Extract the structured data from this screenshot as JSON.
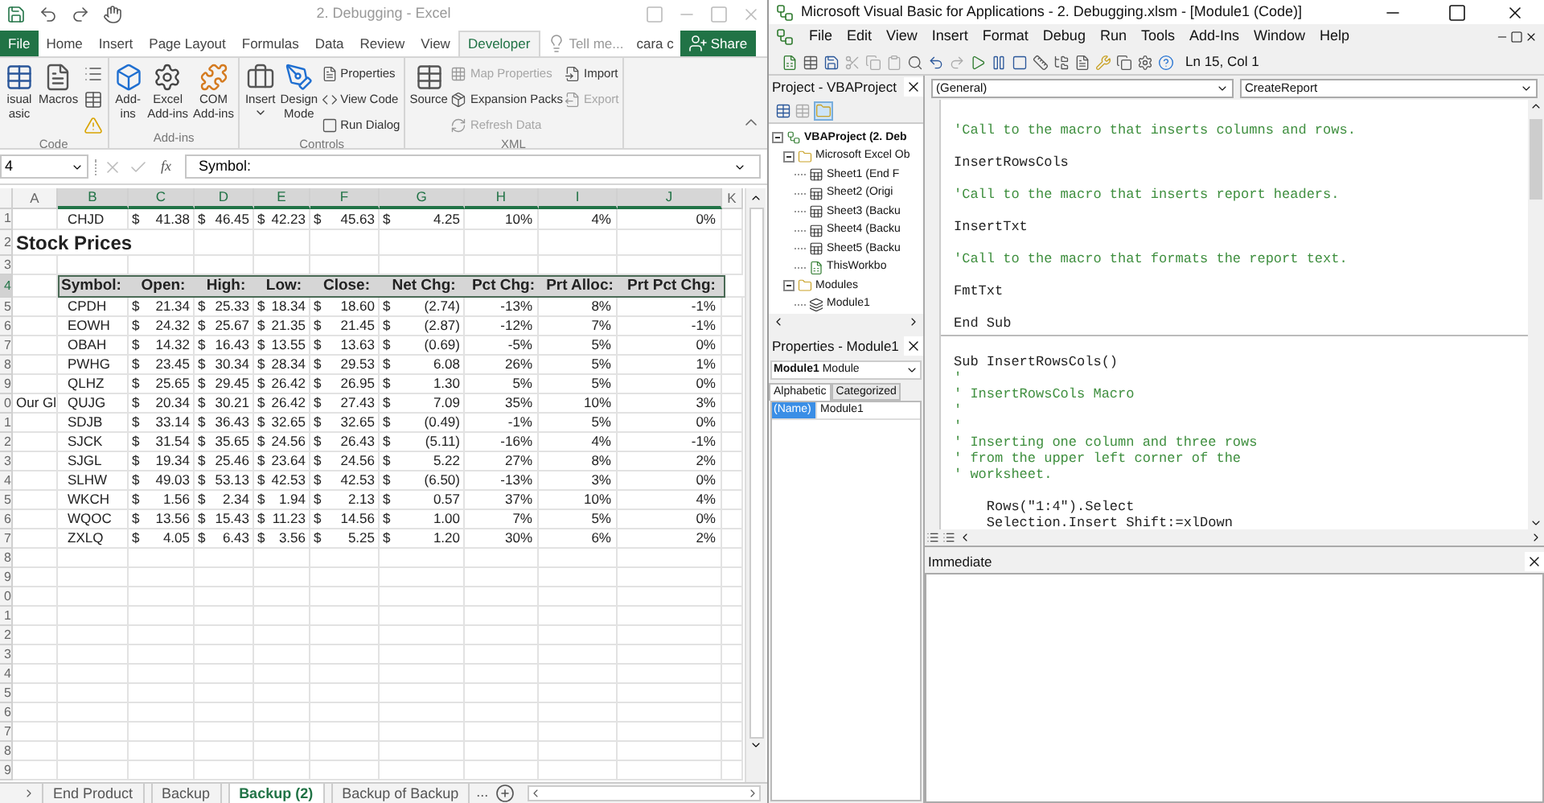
{
  "excel": {
    "title": "2. Debugging - Excel",
    "tabs": [
      {
        "label": "File",
        "kind": "file",
        "selected": false
      },
      {
        "label": "Home",
        "kind": "tab",
        "selected": false
      },
      {
        "label": "Insert",
        "kind": "tab",
        "selected": false
      },
      {
        "label": "Page Layout",
        "kind": "tab",
        "selected": false
      },
      {
        "label": "Formulas",
        "kind": "tab",
        "selected": false
      },
      {
        "label": "Data",
        "kind": "tab",
        "selected": false
      },
      {
        "label": "Review",
        "kind": "tab",
        "selected": false
      },
      {
        "label": "View",
        "kind": "tab",
        "selected": false
      },
      {
        "label": "Developer",
        "kind": "tab",
        "selected": true
      }
    ],
    "tell_me": "Tell me...",
    "user": "cara c",
    "share": "Share",
    "ribbon_groups": [
      {
        "label": "Code",
        "items": [
          {
            "kind": "large",
            "lines": [
              "isual",
              "asic"
            ]
          },
          {
            "kind": "large",
            "lines": [
              "Macros"
            ]
          },
          {
            "kind": "stack",
            "items": [
              {
                "kind": "icon"
              },
              {
                "kind": "icon"
              },
              {
                "kind": "icon"
              }
            ]
          }
        ]
      },
      {
        "label": "Add-ins",
        "items": [
          {
            "kind": "large",
            "lines": [
              "Add-",
              "ins"
            ]
          },
          {
            "kind": "large",
            "lines": [
              "Excel",
              "Add-ins"
            ]
          },
          {
            "kind": "large",
            "lines": [
              "COM",
              "Add-ins"
            ]
          }
        ]
      },
      {
        "label": "Controls",
        "items": [
          {
            "kind": "large",
            "lines": [
              "Insert"
            ],
            "menu": true
          },
          {
            "kind": "large",
            "lines": [
              "Design",
              "Mode"
            ]
          },
          {
            "kind": "stack",
            "items": [
              {
                "kind": "small",
                "label": "Properties",
                "disabled": false
              },
              {
                "kind": "small",
                "label": "View Code",
                "disabled": false
              },
              {
                "kind": "small",
                "label": "Run Dialog",
                "disabled": false
              }
            ]
          }
        ]
      },
      {
        "label": "XML",
        "items": [
          {
            "kind": "large",
            "lines": [
              "Source"
            ]
          },
          {
            "kind": "stack",
            "items": [
              {
                "kind": "small",
                "label": "Map Properties",
                "disabled": true
              },
              {
                "kind": "small",
                "label": "Expansion Packs",
                "disabled": false
              },
              {
                "kind": "small",
                "label": "Refresh Data",
                "disabled": true
              }
            ]
          },
          {
            "kind": "stack",
            "items": [
              {
                "kind": "small",
                "label": "Import",
                "disabled": false
              },
              {
                "kind": "small",
                "label": "Export",
                "disabled": true
              }
            ]
          }
        ]
      }
    ],
    "name_box": "4",
    "function_symbol": "fx",
    "formula": "Symbol:",
    "columns": [
      {
        "label": "A",
        "selected": false
      },
      {
        "label": "B",
        "selected": true
      },
      {
        "label": "C",
        "selected": true
      },
      {
        "label": "D",
        "selected": true
      },
      {
        "label": "E",
        "selected": true
      },
      {
        "label": "F",
        "selected": true
      },
      {
        "label": "G",
        "selected": true
      },
      {
        "label": "H",
        "selected": true
      },
      {
        "label": "I",
        "selected": true
      },
      {
        "label": "J",
        "selected": true
      },
      {
        "label": "K",
        "selected": false
      }
    ],
    "rows": [
      {
        "num": "1",
        "kind": "data",
        "selected": false,
        "symbol": "CHJD",
        "prices": [
          [
            "$",
            "41.38"
          ],
          [
            "$",
            "46.45"
          ],
          [
            "$",
            "42.23"
          ],
          [
            "$",
            "45.63"
          ],
          [
            "$",
            "4.25"
          ]
        ],
        "percents": [
          "10%",
          "4%",
          "0%"
        ]
      },
      {
        "num": "2",
        "kind": "title",
        "selected": false,
        "text": "Stock Prices"
      },
      {
        "num": "3",
        "kind": "empty",
        "selected": false
      },
      {
        "num": "4",
        "kind": "header",
        "selected": true,
        "labels": [
          "Symbol:",
          "Open:",
          "High:",
          "Low:",
          "Close:",
          "Net Chg:",
          "Pct Chg:",
          "Prt Alloc:",
          "Prt Pct Chg:"
        ]
      },
      {
        "num": "5",
        "kind": "data",
        "selected": false,
        "symbol": "CPDH",
        "prices": [
          [
            "$",
            "21.34"
          ],
          [
            "$",
            "25.33"
          ],
          [
            "$",
            "18.34"
          ],
          [
            "$",
            "18.60"
          ],
          [
            "$",
            "(2.74)"
          ]
        ],
        "percents": [
          "-13%",
          "8%",
          "-1%"
        ]
      },
      {
        "num": "6",
        "kind": "data",
        "selected": false,
        "symbol": "EOWH",
        "prices": [
          [
            "$",
            "24.32"
          ],
          [
            "$",
            "25.67"
          ],
          [
            "$",
            "21.35"
          ],
          [
            "$",
            "21.45"
          ],
          [
            "$",
            "(2.87)"
          ]
        ],
        "percents": [
          "-12%",
          "7%",
          "-1%"
        ]
      },
      {
        "num": "7",
        "kind": "data",
        "selected": false,
        "symbol": "OBAH",
        "prices": [
          [
            "$",
            "14.32"
          ],
          [
            "$",
            "16.43"
          ],
          [
            "$",
            "13.55"
          ],
          [
            "$",
            "13.63"
          ],
          [
            "$",
            "(0.69)"
          ]
        ],
        "percents": [
          "-5%",
          "5%",
          "0%"
        ]
      },
      {
        "num": "8",
        "kind": "data",
        "selected": false,
        "symbol": "PWHG",
        "prices": [
          [
            "$",
            "23.45"
          ],
          [
            "$",
            "30.34"
          ],
          [
            "$",
            "28.34"
          ],
          [
            "$",
            "29.53"
          ],
          [
            "$",
            "6.08"
          ]
        ],
        "percents": [
          "26%",
          "5%",
          "1%"
        ]
      },
      {
        "num": "9",
        "kind": "data",
        "selected": false,
        "symbol": "QLHZ",
        "prices": [
          [
            "$",
            "25.65"
          ],
          [
            "$",
            "29.45"
          ],
          [
            "$",
            "26.42"
          ],
          [
            "$",
            "26.95"
          ],
          [
            "$",
            "1.30"
          ]
        ],
        "percents": [
          "5%",
          "5%",
          "0%"
        ]
      },
      {
        "num": "0",
        "kind": "data",
        "selected": false,
        "label": "Our Gl",
        "symbol": "QUJG",
        "prices": [
          [
            "$",
            "20.34"
          ],
          [
            "$",
            "30.21"
          ],
          [
            "$",
            "26.42"
          ],
          [
            "$",
            "27.43"
          ],
          [
            "$",
            "7.09"
          ]
        ],
        "percents": [
          "35%",
          "10%",
          "3%"
        ]
      },
      {
        "num": "1",
        "kind": "data",
        "selected": false,
        "symbol": "SDJB",
        "prices": [
          [
            "$",
            "33.14"
          ],
          [
            "$",
            "36.43"
          ],
          [
            "$",
            "32.65"
          ],
          [
            "$",
            "32.65"
          ],
          [
            "$",
            "(0.49)"
          ]
        ],
        "percents": [
          "-1%",
          "5%",
          "0%"
        ]
      },
      {
        "num": "2",
        "kind": "data",
        "selected": false,
        "symbol": "SJCK",
        "prices": [
          [
            "$",
            "31.54"
          ],
          [
            "$",
            "35.65"
          ],
          [
            "$",
            "24.56"
          ],
          [
            "$",
            "26.43"
          ],
          [
            "$",
            "(5.11)"
          ]
        ],
        "percents": [
          "-16%",
          "4%",
          "-1%"
        ]
      },
      {
        "num": "3",
        "kind": "data",
        "selected": false,
        "symbol": "SJGL",
        "prices": [
          [
            "$",
            "19.34"
          ],
          [
            "$",
            "25.46"
          ],
          [
            "$",
            "23.64"
          ],
          [
            "$",
            "24.56"
          ],
          [
            "$",
            "5.22"
          ]
        ],
        "percents": [
          "27%",
          "8%",
          "2%"
        ]
      },
      {
        "num": "4",
        "kind": "data",
        "selected": false,
        "symbol": "SLHW",
        "prices": [
          [
            "$",
            "49.03"
          ],
          [
            "$",
            "53.13"
          ],
          [
            "$",
            "42.53"
          ],
          [
            "$",
            "42.53"
          ],
          [
            "$",
            "(6.50)"
          ]
        ],
        "percents": [
          "-13%",
          "3%",
          "0%"
        ]
      },
      {
        "num": "5",
        "kind": "data",
        "selected": false,
        "symbol": "WKCH",
        "prices": [
          [
            "$",
            "1.56"
          ],
          [
            "$",
            "2.34"
          ],
          [
            "$",
            "1.94"
          ],
          [
            "$",
            "2.13"
          ],
          [
            "$",
            "0.57"
          ]
        ],
        "percents": [
          "37%",
          "10%",
          "4%"
        ]
      },
      {
        "num": "6",
        "kind": "data",
        "selected": false,
        "symbol": "WQOC",
        "prices": [
          [
            "$",
            "13.56"
          ],
          [
            "$",
            "15.43"
          ],
          [
            "$",
            "11.23"
          ],
          [
            "$",
            "14.56"
          ],
          [
            "$",
            "1.00"
          ]
        ],
        "percents": [
          "7%",
          "5%",
          "0%"
        ]
      },
      {
        "num": "7",
        "kind": "data",
        "selected": false,
        "symbol": "ZXLQ",
        "prices": [
          [
            "$",
            "4.05"
          ],
          [
            "$",
            "6.43"
          ],
          [
            "$",
            "3.56"
          ],
          [
            "$",
            "5.25"
          ],
          [
            "$",
            "1.20"
          ]
        ],
        "percents": [
          "30%",
          "6%",
          "2%"
        ]
      },
      {
        "num": "8",
        "kind": "empty",
        "selected": false
      },
      {
        "num": "9",
        "kind": "empty",
        "selected": false
      },
      {
        "num": "0",
        "kind": "empty",
        "selected": false
      },
      {
        "num": "1",
        "kind": "empty",
        "selected": false
      },
      {
        "num": "2",
        "kind": "empty",
        "selected": false
      },
      {
        "num": "3",
        "kind": "empty",
        "selected": false
      },
      {
        "num": "4",
        "kind": "empty",
        "selected": false
      },
      {
        "num": "5",
        "kind": "empty",
        "selected": false
      },
      {
        "num": "6",
        "kind": "empty",
        "selected": false
      },
      {
        "num": "7",
        "kind": "empty",
        "selected": false
      },
      {
        "num": "8",
        "kind": "empty",
        "selected": false
      },
      {
        "num": "9",
        "kind": "empty",
        "selected": false
      }
    ],
    "sheet_tabs": [
      {
        "label": "End Product",
        "selected": false
      },
      {
        "label": "Backup",
        "selected": false
      },
      {
        "label": "Backup (2)",
        "selected": true
      },
      {
        "label": "Backup of Backup",
        "selected": false
      }
    ],
    "more_sheets": "..."
  },
  "vba": {
    "title": "Microsoft Visual Basic for Applications - 2. Debugging.xlsm - [Module1 (Code)]",
    "menus": [
      "File",
      "Edit",
      "View",
      "Insert",
      "Format",
      "Debug",
      "Run",
      "Tools",
      "Add-Ins",
      "Window",
      "Help"
    ],
    "position": "Ln 15, Col 1",
    "project": {
      "title": "Project - VBAProject",
      "tree": [
        {
          "label": "VBAProject (2. Deb",
          "kind": "project",
          "expanded": true,
          "children": [
            {
              "label": "Microsoft Excel Ob",
              "kind": "folder",
              "expanded": true,
              "children": [
                {
                  "label": "Sheet1 (End F",
                  "kind": "sheet"
                },
                {
                  "label": "Sheet2 (Origi",
                  "kind": "sheet"
                },
                {
                  "label": "Sheet3 (Backu",
                  "kind": "sheet"
                },
                {
                  "label": "Sheet4 (Backu",
                  "kind": "sheet"
                },
                {
                  "label": "Sheet5 (Backu",
                  "kind": "sheet"
                },
                {
                  "label": "ThisWorkbo",
                  "kind": "workbook"
                }
              ]
            },
            {
              "label": "Modules",
              "kind": "folder",
              "expanded": true,
              "children": [
                {
                  "label": "Module1",
                  "kind": "module"
                }
              ]
            }
          ]
        }
      ]
    },
    "properties": {
      "title": "Properties - Module1",
      "object": "Module1",
      "object_type": "Module",
      "tabs": [
        {
          "label": "Alphabetic",
          "selected": true
        },
        {
          "label": "Categorized",
          "selected": false
        }
      ],
      "rows": [
        {
          "name": "(Name)",
          "value": "Module1",
          "selected": true
        }
      ]
    },
    "code": {
      "object": "(General)",
      "procedure": "CreateReport",
      "procedures": [
        {
          "lines": [
            {
              "kind": "comment",
              "text": "'Call to the macro that inserts columns and rows."
            },
            {
              "kind": "blank"
            },
            {
              "kind": "code",
              "text": "InsertRowsCols"
            },
            {
              "kind": "blank"
            },
            {
              "kind": "comment",
              "text": "'Call to the macro that inserts report headers."
            },
            {
              "kind": "blank"
            },
            {
              "kind": "code",
              "text": "InsertTxt"
            },
            {
              "kind": "blank"
            },
            {
              "kind": "comment",
              "text": "'Call to the macro that formats the report text."
            },
            {
              "kind": "blank"
            },
            {
              "kind": "code",
              "text": "FmtTxt"
            },
            {
              "kind": "blank"
            },
            {
              "kind": "code",
              "text": "End Sub"
            }
          ]
        },
        {
          "lines": [
            {
              "kind": "code",
              "text": "Sub InsertRowsCols()"
            },
            {
              "kind": "comment",
              "text": "'"
            },
            {
              "kind": "comment",
              "text": "' InsertRowsCols Macro"
            },
            {
              "kind": "comment",
              "text": "'"
            },
            {
              "kind": "comment",
              "text": "'"
            },
            {
              "kind": "comment",
              "text": "' Inserting one column and three rows"
            },
            {
              "kind": "comment",
              "text": "' from the upper left corner of the"
            },
            {
              "kind": "comment",
              "text": "' worksheet."
            },
            {
              "kind": "blank"
            },
            {
              "kind": "code",
              "text": "    Rows(\"1:4\").Select"
            },
            {
              "kind": "code",
              "text": "    Selection.Insert Shift:=xlDown"
            }
          ]
        }
      ]
    },
    "immediate": {
      "title": "Immediate"
    }
  }
}
